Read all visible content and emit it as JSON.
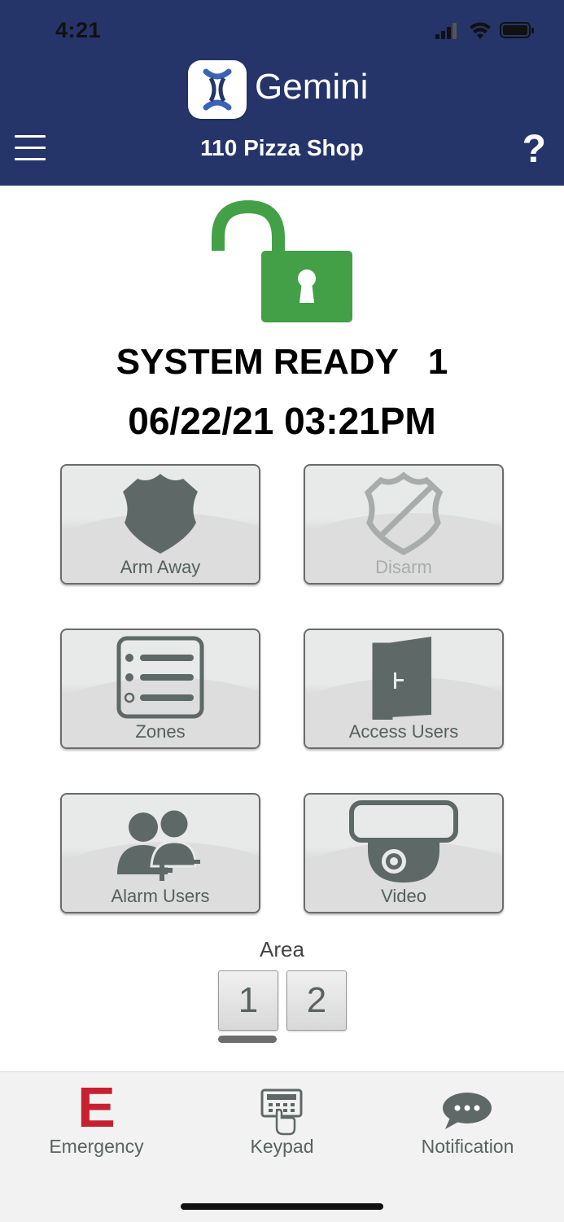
{
  "status_bar": {
    "time": "4:21"
  },
  "header": {
    "app_name": "Gemini",
    "location": "110 Pizza Shop",
    "help_label": "?"
  },
  "system": {
    "status_text": "SYSTEM READY   1",
    "datetime": "06/22/21 03:21PM",
    "lock_state": "unlocked",
    "lock_color": "#43a047"
  },
  "actions": [
    {
      "label": "Arm Away",
      "icon": "police-badge-icon",
      "enabled": true
    },
    {
      "label": "Disarm",
      "icon": "badge-slash-icon",
      "enabled": false
    },
    {
      "label": "Zones",
      "icon": "list-icon",
      "enabled": true
    },
    {
      "label": "Access Users",
      "icon": "door-icon",
      "enabled": true
    },
    {
      "label": "Alarm Users",
      "icon": "users-add-remove-icon",
      "enabled": true
    },
    {
      "label": "Video",
      "icon": "dome-camera-icon",
      "enabled": true
    }
  ],
  "area": {
    "label": "Area",
    "options": [
      "1",
      "2"
    ],
    "selected": "1"
  },
  "tabbar": {
    "emergency": {
      "glyph": "E",
      "label": "Emergency",
      "color": "#c7202e"
    },
    "keypad": {
      "label": "Keypad"
    },
    "notification": {
      "label": "Notification"
    }
  },
  "colors": {
    "header_bg": "#25356a",
    "icon_gray": "#5e6866",
    "disabled_gray": "#a8acab"
  }
}
